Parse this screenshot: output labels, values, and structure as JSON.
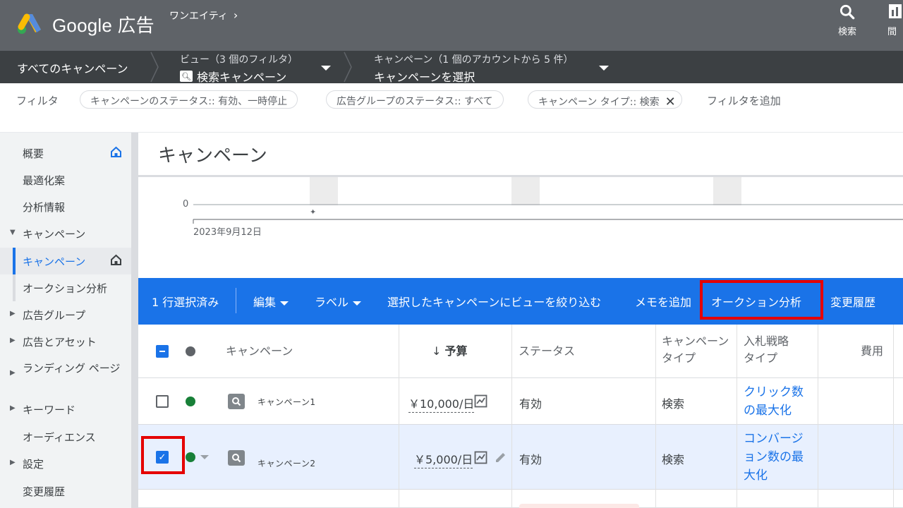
{
  "header": {
    "brand": "Google 広告",
    "account": "ワンエイティ",
    "search_label": "検索",
    "extra_label": "間"
  },
  "navbar": {
    "all_campaigns": "すべてのキャンペーン",
    "view_label": "ビュー（3 個のフィルタ）",
    "view_value": "検索キャンペーン",
    "campaign_label": "キャンペーン（1 個のアカウントから 5 件）",
    "campaign_value": "キャンペーンを選択"
  },
  "filters": {
    "label": "フィルタ",
    "chips": [
      "キャンペーンのステータス:: 有効、一時停止",
      "広告グループのステータス:: すべて",
      "キャンペーン タイプ:: 検索"
    ],
    "add": "フィルタを追加"
  },
  "sidebar": {
    "items": [
      {
        "label": "概要"
      },
      {
        "label": "最適化案"
      },
      {
        "label": "分析情報"
      },
      {
        "label": "キャンペーン"
      },
      {
        "label": "キャンペーン"
      },
      {
        "label": "オークション分析"
      },
      {
        "label": "広告グループ"
      },
      {
        "label": "広告とアセット"
      },
      {
        "label": "ランディング ページ"
      },
      {
        "label": "キーワード"
      },
      {
        "label": "オーディエンス"
      },
      {
        "label": "設定"
      },
      {
        "label": "変更履歴"
      }
    ]
  },
  "main": {
    "title": "キャンペーン",
    "chart_zero": "0",
    "chart_date": "2023年9月12日"
  },
  "toolbar": {
    "selected": "1 行選択済み",
    "edit": "編集",
    "label": "ラベル",
    "filter_view": "選択したキャンペーンにビューを絞り込む",
    "add_memo": "メモを追加",
    "auction": "オークション分析",
    "history": "変更履歴"
  },
  "table": {
    "headers": {
      "campaign": "キャンペーン",
      "budget": "予算",
      "status": "ステータス",
      "type_1": "キャンペーン",
      "type_2": "タイプ",
      "bid_1": "入札戦略",
      "bid_2": "タイプ",
      "cost": "費用"
    },
    "rows": [
      {
        "name": "キャンペーン1",
        "budget": "￥10,000/日",
        "status": "有効",
        "type": "検索",
        "bid_1": "クリック数",
        "bid_2": "の最大化"
      },
      {
        "name": "キャンペーン2",
        "budget": "￥5,000/日",
        "status": "有効",
        "type": "検索",
        "bid_1": "コンバージ",
        "bid_2": "ョン数の最",
        "bid_3": "大化"
      }
    ]
  },
  "colors": {
    "primary": "#1a73e8",
    "header_bg": "#5f6368",
    "nav_bg": "#3c4043",
    "status_green": "#188038",
    "highlight_red": "#e50000"
  }
}
